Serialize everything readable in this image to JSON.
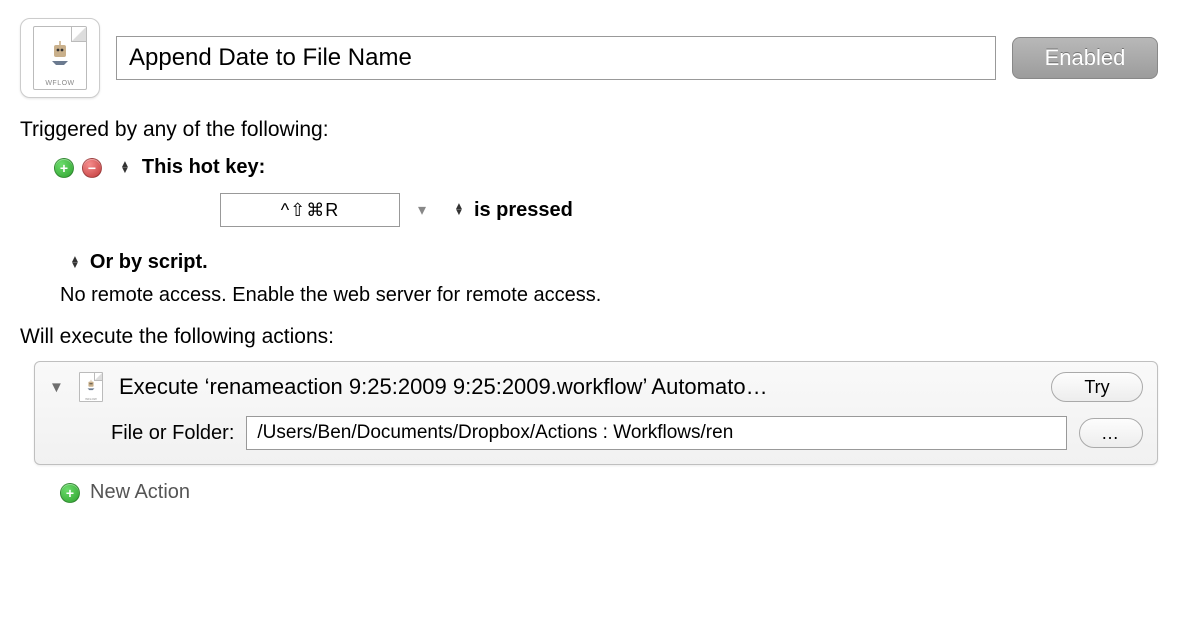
{
  "header": {
    "icon_label": "WFLOW",
    "title": "Append Date to File Name",
    "enabled_label": "Enabled"
  },
  "triggers": {
    "section_label": "Triggered by any of the following:",
    "hotkey_label": "This hot key:",
    "hotkey_value": "^⇧⌘R",
    "pressed_label": "is pressed",
    "script_label": "Or by script.",
    "remote_text": "No remote access.  Enable the web server for remote access."
  },
  "actions": {
    "section_label": "Will execute the following actions:",
    "item": {
      "title": "Execute ‘renameaction 9:25:2009 9:25:2009.workflow’ Automato…",
      "try_label": "Try",
      "file_label": "File or Folder:",
      "path": "/Users/Ben/Documents/Dropbox/Actions : Workflows/ren",
      "browse_label": "…"
    },
    "new_action_label": "New Action"
  },
  "glyphs": {
    "plus": "+",
    "minus": "−",
    "up": "▲",
    "down": "▼",
    "caret_down": "▾",
    "disclosure_down": "▼"
  }
}
